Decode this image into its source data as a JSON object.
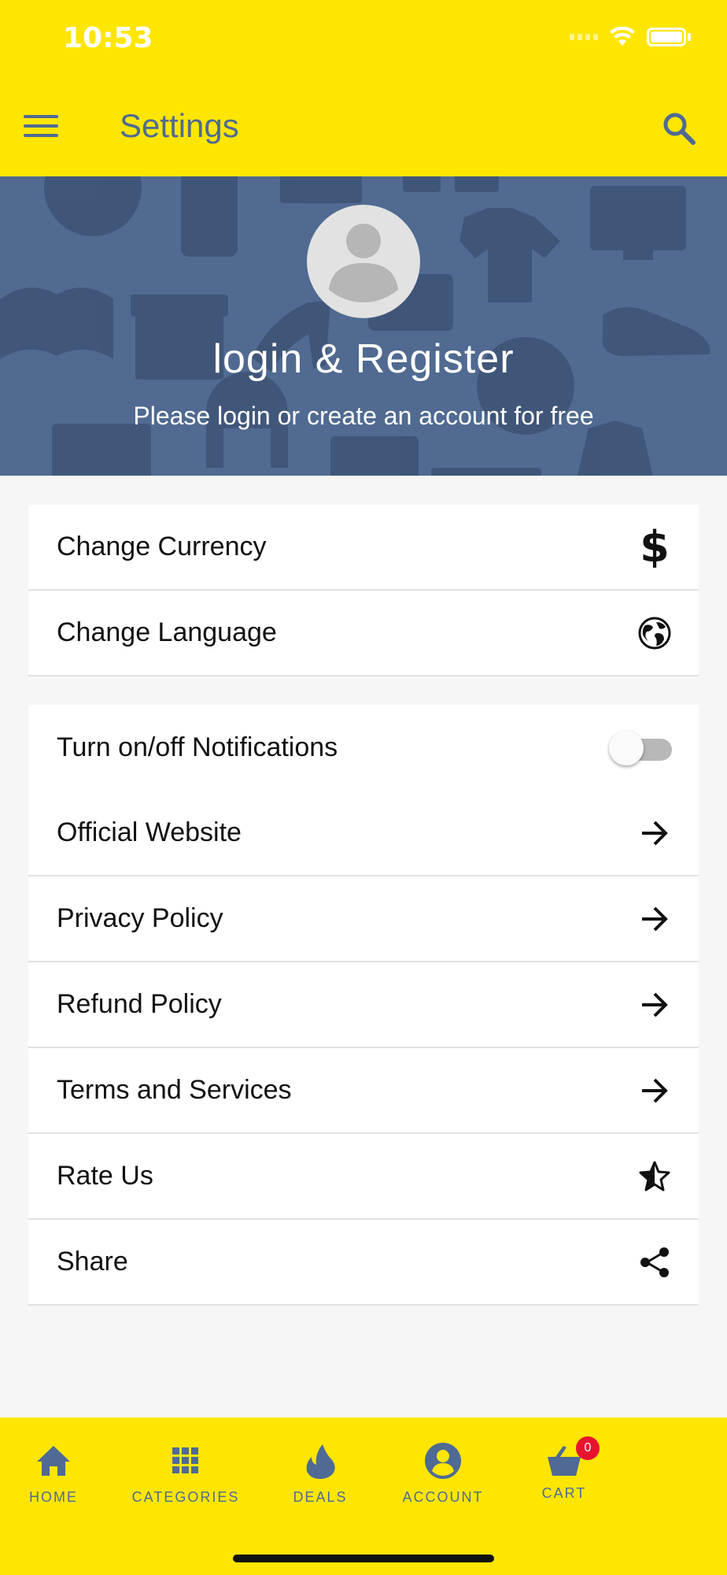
{
  "status_bar": {
    "time": "10:53"
  },
  "app_bar": {
    "title": "Settings",
    "menu_icon": "hamburger-menu-icon",
    "search_icon": "search-icon"
  },
  "hero": {
    "title": "login & Register",
    "subtitle": "Please login or create an account for free",
    "background_color": "#506a91"
  },
  "settings_group_1": [
    {
      "label": "Change Currency",
      "icon": "dollar-icon"
    },
    {
      "label": "Change Language",
      "icon": "globe-icon"
    }
  ],
  "settings_group_2": [
    {
      "label": "Turn on/off Notifications",
      "icon": "toggle-switch",
      "enabled": false
    },
    {
      "label": "Official Website",
      "icon": "arrow-right-icon"
    },
    {
      "label": "Privacy Policy",
      "icon": "arrow-right-icon"
    },
    {
      "label": "Refund Policy",
      "icon": "arrow-right-icon"
    },
    {
      "label": "Terms and Services",
      "icon": "arrow-right-icon"
    },
    {
      "label": "Rate Us",
      "icon": "star-half-icon"
    },
    {
      "label": "Share",
      "icon": "share-icon"
    }
  ],
  "bottom_nav": {
    "items": [
      {
        "label": "HOME",
        "icon": "home-icon"
      },
      {
        "label": "CATEGORIES",
        "icon": "grid-icon"
      },
      {
        "label": "DEALS",
        "icon": "flame-icon"
      },
      {
        "label": "ACCOUNT",
        "icon": "account-icon"
      },
      {
        "label": "CART",
        "icon": "cart-basket-icon",
        "badge": "0"
      }
    ]
  },
  "colors": {
    "primary_yellow": "#ffe600",
    "accent_blue": "#4f6a94",
    "badge_red": "#e8132f"
  }
}
